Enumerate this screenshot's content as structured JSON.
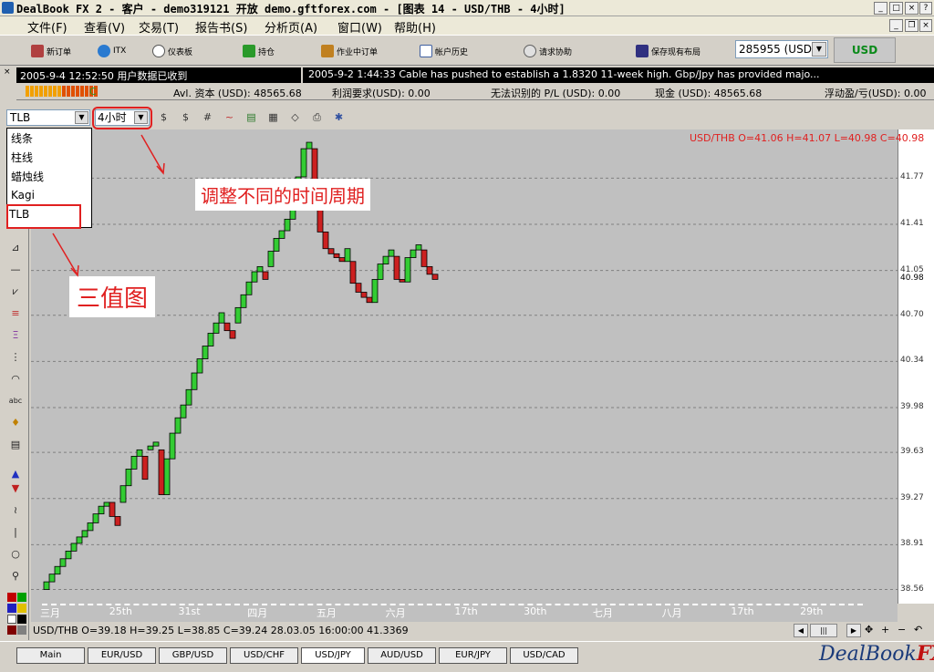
{
  "window": {
    "title": "DealBook FX 2 - 客户 - demo319121 开放 demo.gftforex.com - [图表 14 - USD/THB - 4小时]"
  },
  "menu": [
    "文件(F)",
    "查看(V)",
    "交易(T)",
    "报告书(S)",
    "分析页(A)",
    "窗口(W)",
    "帮助(H)"
  ],
  "toolbar": {
    "items": [
      {
        "label": "新订单",
        "icon": "new-order-icon",
        "color": "#b04040"
      },
      {
        "label": "ITX",
        "icon": "globe-icon",
        "color": "#2a7ad0"
      },
      {
        "label": "仪表板",
        "icon": "dashboard-icon",
        "color": "#808080"
      },
      {
        "label": "持仓",
        "icon": "position-icon",
        "color": "#2a9a2a"
      },
      {
        "label": "作业中订单",
        "icon": "working-orders-icon",
        "color": "#c08020"
      },
      {
        "label": "帐户历史",
        "icon": "account-history-icon",
        "color": "#4060a0"
      },
      {
        "label": "请求协助",
        "icon": "help-request-icon",
        "color": "#606060"
      },
      {
        "label": "保存现有布局",
        "icon": "save-layout-icon",
        "color": "#303080"
      }
    ],
    "account": "285955 (USD",
    "currency": "USD"
  },
  "news": {
    "left": "2005-9-4 12:52:50 用户数据已收到",
    "right": "2005-9-2 1:44:33 Cable has pushed to establish a 1.8320 11-week high. Gbp/Jpy has      provided majo..."
  },
  "stats": {
    "c_label": "C",
    "avl": "Avl. 资本 (USD): 48565.68",
    "margin": "利润要求(USD): 0.00",
    "unrecognized": "无法识别的 P/L (USD): 0.00",
    "cash": "现金 (USD): 48565.68",
    "floating": "浮动盈/亏(USD): 0.00"
  },
  "controls": {
    "chart_type": "TLB",
    "period": "4小时",
    "dropdown_options": [
      "线条",
      "柱线",
      "蜡烛线",
      "Kagi",
      "TLB"
    ]
  },
  "annotations": {
    "period_note": "调整不同的时间周期",
    "tlb_note": "三值图"
  },
  "chart_data": {
    "type": "bar",
    "title": "",
    "ohlc_label": "USD/THB O=41.06 H=41.07 L=40.98 C=40.98",
    "xlabel": "",
    "ylabel": "",
    "ylim": [
      38.45,
      42.15
    ],
    "y_ticks": [
      38.56,
      38.91,
      39.27,
      39.63,
      39.98,
      40.34,
      40.7,
      41.05,
      41.41,
      41.77
    ],
    "last_price": 40.98,
    "x_ticks": [
      "三月",
      "25th",
      "31st",
      "四月",
      "五月",
      "六月",
      "17th",
      "30th",
      "七月",
      "八月",
      "17th",
      "29th"
    ],
    "bricks_note": "Three line break bricks: direction, open, close (USD/THB)",
    "bricks": [
      {
        "dir": "up",
        "open": 38.56,
        "close": 38.62
      },
      {
        "dir": "up",
        "open": 38.62,
        "close": 38.68
      },
      {
        "dir": "up",
        "open": 38.68,
        "close": 38.74
      },
      {
        "dir": "up",
        "open": 38.74,
        "close": 38.8
      },
      {
        "dir": "up",
        "open": 38.8,
        "close": 38.86
      },
      {
        "dir": "up",
        "open": 38.86,
        "close": 38.92
      },
      {
        "dir": "up",
        "open": 38.92,
        "close": 38.97
      },
      {
        "dir": "up",
        "open": 38.97,
        "close": 39.02
      },
      {
        "dir": "up",
        "open": 39.02,
        "close": 39.08
      },
      {
        "dir": "up",
        "open": 39.08,
        "close": 39.15
      },
      {
        "dir": "up",
        "open": 39.15,
        "close": 39.21
      },
      {
        "dir": "up",
        "open": 39.21,
        "close": 39.24
      },
      {
        "dir": "down",
        "open": 39.24,
        "close": 39.13
      },
      {
        "dir": "down",
        "open": 39.13,
        "close": 39.06
      },
      {
        "dir": "up",
        "open": 39.24,
        "close": 39.37
      },
      {
        "dir": "up",
        "open": 39.37,
        "close": 39.5
      },
      {
        "dir": "up",
        "open": 39.5,
        "close": 39.6
      },
      {
        "dir": "up",
        "open": 39.6,
        "close": 39.65
      },
      {
        "dir": "down",
        "open": 39.6,
        "close": 39.42
      },
      {
        "dir": "up",
        "open": 39.65,
        "close": 39.68
      },
      {
        "dir": "up",
        "open": 39.68,
        "close": 39.71
      },
      {
        "dir": "down",
        "open": 39.65,
        "close": 39.3
      },
      {
        "dir": "up",
        "open": 39.3,
        "close": 39.58
      },
      {
        "dir": "up",
        "open": 39.58,
        "close": 39.78
      },
      {
        "dir": "up",
        "open": 39.78,
        "close": 39.9
      },
      {
        "dir": "up",
        "open": 39.9,
        "close": 40.0
      },
      {
        "dir": "up",
        "open": 40.0,
        "close": 40.12
      },
      {
        "dir": "up",
        "open": 40.12,
        "close": 40.25
      },
      {
        "dir": "up",
        "open": 40.25,
        "close": 40.36
      },
      {
        "dir": "up",
        "open": 40.36,
        "close": 40.46
      },
      {
        "dir": "up",
        "open": 40.46,
        "close": 40.56
      },
      {
        "dir": "up",
        "open": 40.56,
        "close": 40.64
      },
      {
        "dir": "up",
        "open": 40.64,
        "close": 40.72
      },
      {
        "dir": "down",
        "open": 40.64,
        "close": 40.58
      },
      {
        "dir": "down",
        "open": 40.58,
        "close": 40.52
      },
      {
        "dir": "up",
        "open": 40.64,
        "close": 40.76
      },
      {
        "dir": "up",
        "open": 40.76,
        "close": 40.86
      },
      {
        "dir": "up",
        "open": 40.86,
        "close": 40.96
      },
      {
        "dir": "up",
        "open": 40.96,
        "close": 41.04
      },
      {
        "dir": "up",
        "open": 41.04,
        "close": 41.08
      },
      {
        "dir": "down",
        "open": 41.04,
        "close": 40.98
      },
      {
        "dir": "up",
        "open": 41.08,
        "close": 41.2
      },
      {
        "dir": "up",
        "open": 41.2,
        "close": 41.3
      },
      {
        "dir": "up",
        "open": 41.3,
        "close": 41.36
      },
      {
        "dir": "up",
        "open": 41.36,
        "close": 41.45
      },
      {
        "dir": "up",
        "open": 41.45,
        "close": 41.58
      },
      {
        "dir": "up",
        "open": 41.58,
        "close": 41.78
      },
      {
        "dir": "up",
        "open": 41.78,
        "close": 42.0
      },
      {
        "dir": "up",
        "open": 42.0,
        "close": 42.05
      },
      {
        "dir": "down",
        "open": 42.0,
        "close": 41.65
      },
      {
        "dir": "down",
        "open": 41.65,
        "close": 41.35
      },
      {
        "dir": "down",
        "open": 41.35,
        "close": 41.22
      },
      {
        "dir": "down",
        "open": 41.22,
        "close": 41.18
      },
      {
        "dir": "down",
        "open": 41.18,
        "close": 41.15
      },
      {
        "dir": "down",
        "open": 41.15,
        "close": 41.12
      },
      {
        "dir": "up",
        "open": 41.12,
        "close": 41.22
      },
      {
        "dir": "down",
        "open": 41.12,
        "close": 40.95
      },
      {
        "dir": "down",
        "open": 40.95,
        "close": 40.88
      },
      {
        "dir": "down",
        "open": 40.88,
        "close": 40.84
      },
      {
        "dir": "down",
        "open": 40.84,
        "close": 40.8
      },
      {
        "dir": "up",
        "open": 40.8,
        "close": 40.98
      },
      {
        "dir": "up",
        "open": 40.98,
        "close": 41.1
      },
      {
        "dir": "up",
        "open": 41.1,
        "close": 41.16
      },
      {
        "dir": "up",
        "open": 41.16,
        "close": 41.21
      },
      {
        "dir": "down",
        "open": 41.16,
        "close": 40.98
      },
      {
        "dir": "down",
        "open": 40.98,
        "close": 40.96
      },
      {
        "dir": "up",
        "open": 40.96,
        "close": 41.15
      },
      {
        "dir": "up",
        "open": 41.15,
        "close": 41.21
      },
      {
        "dir": "up",
        "open": 41.21,
        "close": 41.25
      },
      {
        "dir": "down",
        "open": 41.21,
        "close": 41.08
      },
      {
        "dir": "down",
        "open": 41.08,
        "close": 41.02
      },
      {
        "dir": "down",
        "open": 41.02,
        "close": 40.98
      }
    ]
  },
  "status": {
    "text": "USD/THB O=39.18 H=39.25 L=38.85 C=39.24   28.03.05 16:00:00 41.3369"
  },
  "tabs": [
    "Main",
    "EUR/USD",
    "GBP/USD",
    "USD/CHF",
    "USD/JPY",
    "AUD/USD",
    "EUR/JPY",
    "USD/CAD"
  ],
  "active_tab": "USD/JPY",
  "brand": {
    "name": "DealBook",
    "suffix": "FX",
    "version": "2"
  },
  "colors": {
    "up": "#33cc33",
    "down": "#cc2020",
    "bg": "#c0c0c0",
    "annotation": "#e02020"
  }
}
